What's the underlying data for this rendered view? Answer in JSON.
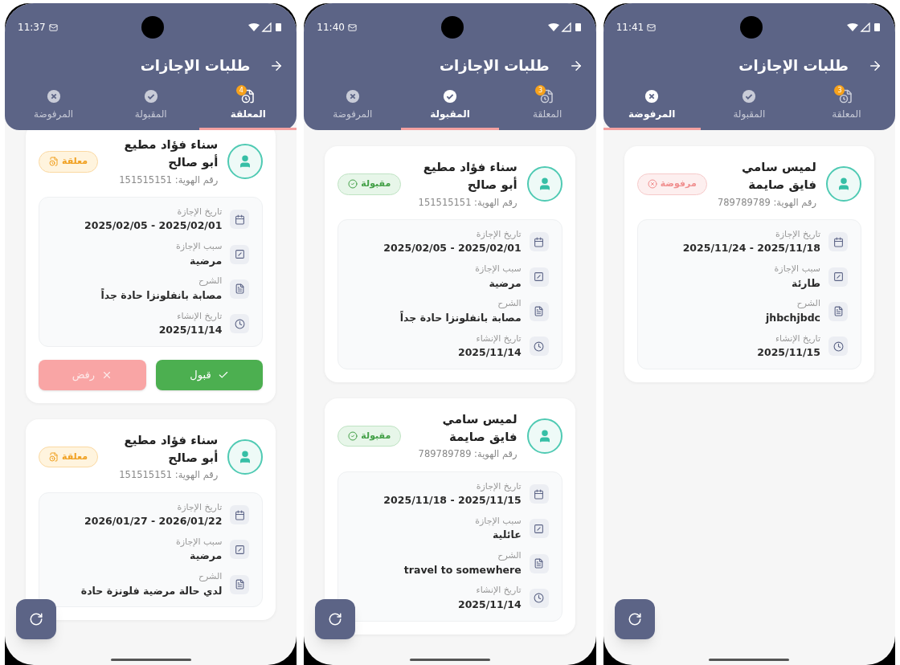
{
  "phones": [
    {
      "status_time": "11:41",
      "title": "طلبات الإجازات",
      "scrolled": false,
      "tabs": [
        {
          "kind": "pending",
          "label": "المعلقة",
          "badge": "3",
          "selected": false
        },
        {
          "kind": "accepted",
          "label": "المقبولة",
          "selected": false
        },
        {
          "kind": "rejected",
          "label": "المرفوضة",
          "selected": true
        }
      ],
      "cards": [
        {
          "name": "لميس سامي فايق صايمة",
          "id_text": "رقم الهوية: 789789789",
          "status": {
            "kind": "rejected",
            "label": "مرفوضة"
          },
          "details": [
            {
              "kind": "calendar",
              "label": "تاريخ الإجازة",
              "value": "2025/11/24 - 2025/11/18"
            },
            {
              "kind": "reason",
              "label": "سبب الإجازة",
              "value": "طارئة"
            },
            {
              "kind": "note",
              "label": "الشرح",
              "value": "jhbchjbdc"
            },
            {
              "kind": "clock",
              "label": "تاريخ الإنشاء",
              "value": "2025/11/15"
            }
          ]
        }
      ]
    },
    {
      "status_time": "11:40",
      "title": "طلبات الإجازات",
      "scrolled": false,
      "tabs": [
        {
          "kind": "pending",
          "label": "المعلقة",
          "badge": "3",
          "selected": false
        },
        {
          "kind": "accepted",
          "label": "المقبولة",
          "selected": true
        },
        {
          "kind": "rejected",
          "label": "المرفوضة",
          "selected": false
        }
      ],
      "cards": [
        {
          "name": "سناء فؤاد مطيع أبو صالح",
          "id_text": "رقم الهوية: 151515151",
          "status": {
            "kind": "accepted",
            "label": "مقبولة"
          },
          "details": [
            {
              "kind": "calendar",
              "label": "تاريخ الإجازة",
              "value": "2025/02/05 - 2025/02/01"
            },
            {
              "kind": "reason",
              "label": "سبب الإجازة",
              "value": "مرضية"
            },
            {
              "kind": "note",
              "label": "الشرح",
              "value": "مصابة بانفلونزا حادة جداً"
            },
            {
              "kind": "clock",
              "label": "تاريخ الإنشاء",
              "value": "2025/11/14"
            }
          ]
        },
        {
          "name": "لميس سامي فايق صايمة",
          "id_text": "رقم الهوية: 789789789",
          "status": {
            "kind": "accepted",
            "label": "مقبولة"
          },
          "details": [
            {
              "kind": "calendar",
              "label": "تاريخ الإجازة",
              "value": "2025/11/18 - 2025/11/15"
            },
            {
              "kind": "reason",
              "label": "سبب الإجازة",
              "value": "عائلية"
            },
            {
              "kind": "note",
              "label": "الشرح",
              "value": "travel to somewhere"
            },
            {
              "kind": "clock",
              "label": "تاريخ الإنشاء",
              "value": "2025/11/14"
            }
          ]
        }
      ]
    },
    {
      "status_time": "11:37",
      "title": "طلبات الإجازات",
      "scrolled": true,
      "tabs": [
        {
          "kind": "pending",
          "label": "المعلقة",
          "badge": "4",
          "selected": true
        },
        {
          "kind": "accepted",
          "label": "المقبولة",
          "selected": false
        },
        {
          "kind": "rejected",
          "label": "المرفوضة",
          "selected": false
        }
      ],
      "cards": [
        {
          "name": "سناء فؤاد مطيع أبو صالح",
          "id_text": "رقم الهوية: 151515151",
          "status": {
            "kind": "pending",
            "label": "معلقة"
          },
          "details": [
            {
              "kind": "calendar",
              "label": "تاريخ الإجازة",
              "value": "2025/02/05 - 2025/02/01"
            },
            {
              "kind": "reason",
              "label": "سبب الإجازة",
              "value": "مرضية"
            },
            {
              "kind": "note",
              "label": "الشرح",
              "value": "مصابة بانفلونزا حادة جداً"
            },
            {
              "kind": "clock",
              "label": "تاريخ الإنشاء",
              "value": "2025/11/14"
            }
          ],
          "actions": [
            {
              "kind": "accept",
              "label": "قبول"
            },
            {
              "kind": "reject",
              "label": "رفض"
            }
          ]
        },
        {
          "name": "سناء فؤاد مطيع أبو صالح",
          "id_text": "رقم الهوية: 151515151",
          "status": {
            "kind": "pending",
            "label": "معلقة"
          },
          "details": [
            {
              "kind": "calendar",
              "label": "تاريخ الإجازة",
              "value": "2026/01/27 - 2026/01/22"
            },
            {
              "kind": "reason",
              "label": "سبب الإجازة",
              "value": "مرضية"
            },
            {
              "kind": "note",
              "label": "الشرح",
              "value": "لدي حالة مرضية فلونزة حادة"
            }
          ]
        }
      ]
    }
  ]
}
